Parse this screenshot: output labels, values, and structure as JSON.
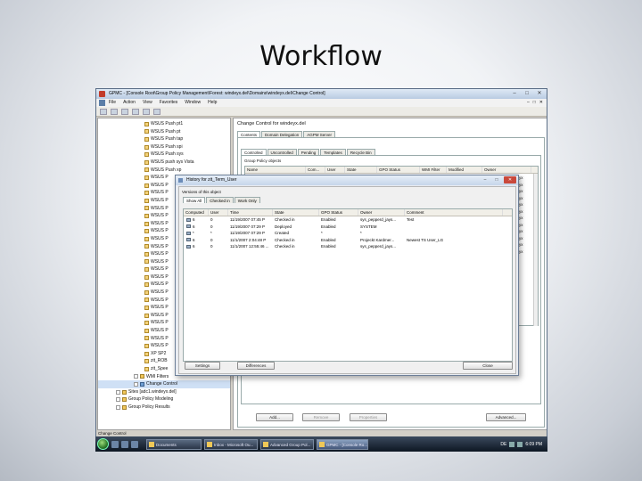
{
  "slide": {
    "title": "Workflow"
  },
  "mmc": {
    "title": "GPMC - [Console Root\\Group Policy Management\\Forest: windeyx.del\\Domains\\windeyx.del\\Change Control]",
    "menu": [
      "File",
      "Action",
      "View",
      "Favorites",
      "Window",
      "Help"
    ],
    "tree": [
      {
        "label": "WSUS Push pt1",
        "icon": "gpo"
      },
      {
        "label": "WSUS Push pt",
        "icon": "gpo"
      },
      {
        "label": "WSUS Push tap",
        "icon": "gpo"
      },
      {
        "label": "WSUS Push spi",
        "icon": "gpo"
      },
      {
        "label": "WSUS Push sys",
        "icon": "gpo"
      },
      {
        "label": "WSUS push sys Vista",
        "icon": "gpo"
      },
      {
        "label": "WSUS Push xp",
        "icon": "gpo"
      },
      {
        "label": "WSUS P",
        "icon": "gpo"
      },
      {
        "label": "WSUS P",
        "icon": "gpo"
      },
      {
        "label": "WSUS P",
        "icon": "gpo"
      },
      {
        "label": "WSUS P",
        "icon": "gpo"
      },
      {
        "label": "WSUS P",
        "icon": "gpo"
      },
      {
        "label": "WSUS P",
        "icon": "gpo"
      },
      {
        "label": "WSUS P",
        "icon": "gpo"
      },
      {
        "label": "WSUS P",
        "icon": "gpo"
      },
      {
        "label": "WSUS P",
        "icon": "gpo"
      },
      {
        "label": "WSUS P",
        "icon": "gpo"
      },
      {
        "label": "WSUS P",
        "icon": "gpo"
      },
      {
        "label": "WSUS P",
        "icon": "gpo"
      },
      {
        "label": "WSUS P",
        "icon": "gpo"
      },
      {
        "label": "WSUS P",
        "icon": "gpo"
      },
      {
        "label": "WSUS P",
        "icon": "gpo"
      },
      {
        "label": "WSUS P",
        "icon": "gpo"
      },
      {
        "label": "WSUS P",
        "icon": "gpo"
      },
      {
        "label": "WSUS P",
        "icon": "gpo"
      },
      {
        "label": "WSUS P",
        "icon": "gpo"
      },
      {
        "label": "WSUS P",
        "icon": "gpo"
      },
      {
        "label": "WSUS P",
        "icon": "gpo"
      },
      {
        "label": "WSUS P",
        "icon": "gpo"
      },
      {
        "label": "WSUS P",
        "icon": "gpo"
      },
      {
        "label": "XP SP2",
        "icon": "gpo"
      },
      {
        "label": "zit_ROB",
        "icon": "gpo"
      },
      {
        "label": "zit_Spee",
        "icon": "gpo"
      },
      {
        "label": "WMI Filters",
        "icon": "folder"
      },
      {
        "label": "Change Control",
        "icon": "cc"
      },
      {
        "label": "Sites [adc1.windeyx.del]",
        "icon": "folder"
      },
      {
        "label": "Group Policy Modeling",
        "icon": "folder"
      },
      {
        "label": "Group Policy Results",
        "icon": "folder"
      }
    ],
    "status": "Change Control",
    "right": {
      "title": "Change Control for windeyx.del",
      "tabs": [
        "Contents",
        "Domain Delegation",
        "AGPM Server"
      ],
      "subtabs": [
        "Controlled",
        "Uncontrolled",
        "Pending",
        "Templates",
        "Recycle Bin"
      ],
      "group_label": "Group Policy objects",
      "columns": [
        "Name",
        "Com...",
        "User",
        "State",
        "GPO Status",
        "WMI Filter",
        "Modified",
        "Owner"
      ],
      "owner_cells": [
        "deyx",
        "deyx",
        "deyx",
        "deyx",
        "deyx",
        "deyx",
        "deyx",
        "deyx",
        "deyx",
        "deyx",
        "deyx",
        "deyx"
      ],
      "buttons": [
        "Add...",
        "Remove",
        "Properties",
        "Advanced..."
      ]
    }
  },
  "dialog": {
    "title": "History for zit_Term_User",
    "group": "Versions of this object",
    "tabs": [
      "Show All",
      "Checked in",
      "Work Only"
    ],
    "columns": [
      "Computed",
      "User",
      "Time",
      "State",
      "GPO Status",
      "Owner",
      "Comment"
    ],
    "rows": [
      {
        "v": "6",
        "user": "0",
        "time": "11/19/2007 07:45 P",
        "state": "Checked in",
        "gpo": "Enabled",
        "owner": "sys_pepperd_jays...",
        "comment": "Test"
      },
      {
        "v": "6",
        "user": "0",
        "time": "11/19/2007 07:29 P",
        "state": "Deployed",
        "gpo": "Enabled",
        "owner": "SYSTEM",
        "comment": ""
      },
      {
        "v": "*",
        "user": "*",
        "time": "11/19/2007 07:29 P",
        "state": "Created",
        "gpo": "*",
        "owner": "*",
        "comment": ""
      },
      {
        "v": "6",
        "user": "0",
        "time": "11/1/2007 2:04:48 P",
        "state": "Checked in",
        "gpo": "Enabled",
        "owner": "Projeckt Kardmer...",
        "comment": "Newest TS User_LG"
      },
      {
        "v": "6",
        "user": "0",
        "time": "11/1/2007 12:55:46 ...",
        "state": "Checked in",
        "gpo": "Enabled",
        "owner": "sys_pepperd_jays...",
        "comment": ""
      }
    ],
    "buttons": {
      "settings": "Settings",
      "differences": "Differences",
      "close": "Close"
    }
  },
  "taskbar": {
    "tasks": [
      {
        "label": "Documents",
        "active": false
      },
      {
        "label": "Inbox - Microsoft Ou...",
        "active": false
      },
      {
        "label": "Advanced Group Pol...",
        "active": false
      },
      {
        "label": "GPMC - [Console Ro...",
        "active": true
      }
    ],
    "lang": "DE",
    "clock": "6:09 PM"
  }
}
